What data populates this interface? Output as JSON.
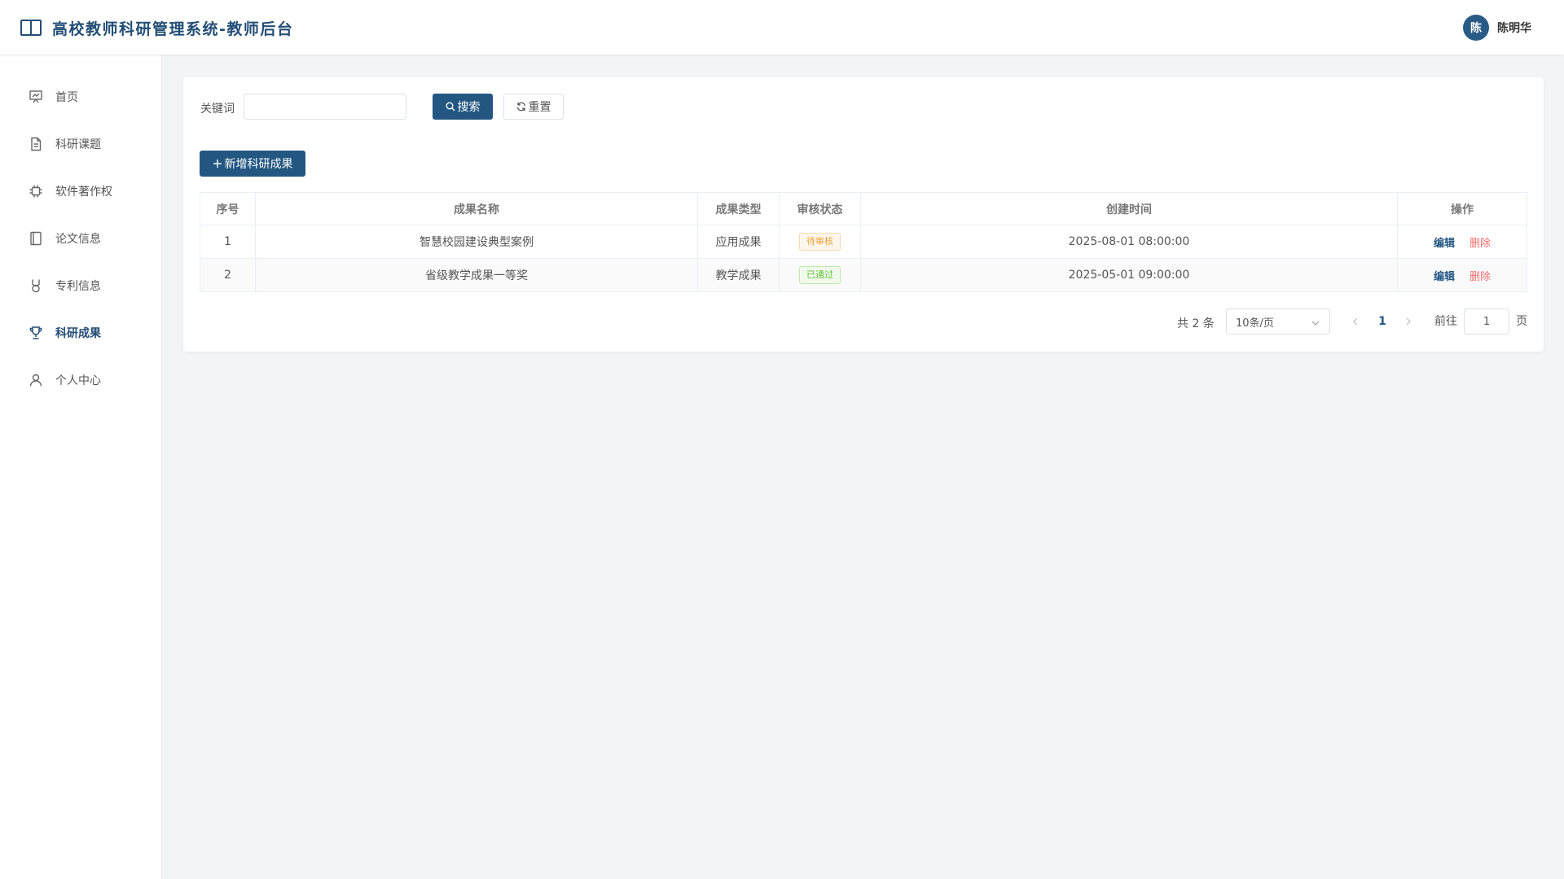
{
  "header": {
    "title": "高校教师科研管理系统-教师后台",
    "avatar_text": "陈",
    "user_name": "陈明华"
  },
  "sidebar": {
    "items": [
      {
        "label": "首页",
        "icon": "presentation-icon"
      },
      {
        "label": "科研课题",
        "icon": "document-icon"
      },
      {
        "label": "软件著作权",
        "icon": "chip-icon"
      },
      {
        "label": "论文信息",
        "icon": "notebook-icon"
      },
      {
        "label": "专利信息",
        "icon": "medal-icon"
      },
      {
        "label": "科研成果",
        "icon": "trophy-icon",
        "active": true
      },
      {
        "label": "个人中心",
        "icon": "user-icon"
      }
    ]
  },
  "search": {
    "label": "关键词",
    "value": "",
    "search_label": "搜索",
    "reset_label": "重置"
  },
  "toolbar": {
    "add_label": "新增科研成果"
  },
  "table": {
    "headers": [
      "序号",
      "成果名称",
      "成果类型",
      "审核状态",
      "创建时间",
      "操作"
    ],
    "rows": [
      {
        "index": "1",
        "name": "智慧校园建设典型案例",
        "type": "应用成果",
        "status": "待审核",
        "created": "2025-08-01 08:00:00",
        "edit": "编辑",
        "delete": "删除"
      },
      {
        "index": "2",
        "name": "省级教学成果一等奖",
        "type": "教学成果",
        "status": "已通过",
        "created": "2025-05-01 09:00:00",
        "edit": "编辑",
        "delete": "删除"
      }
    ]
  },
  "pagination": {
    "total": "共 2 条",
    "page_size": "10条/页",
    "current_page": "1",
    "goto_label": "前往",
    "goto_value": "1",
    "goto_unit": "页"
  },
  "colors": {
    "primary": "#235782",
    "pending": "#e6a23c",
    "passed": "#67c23a",
    "danger": "#f56c6c"
  }
}
